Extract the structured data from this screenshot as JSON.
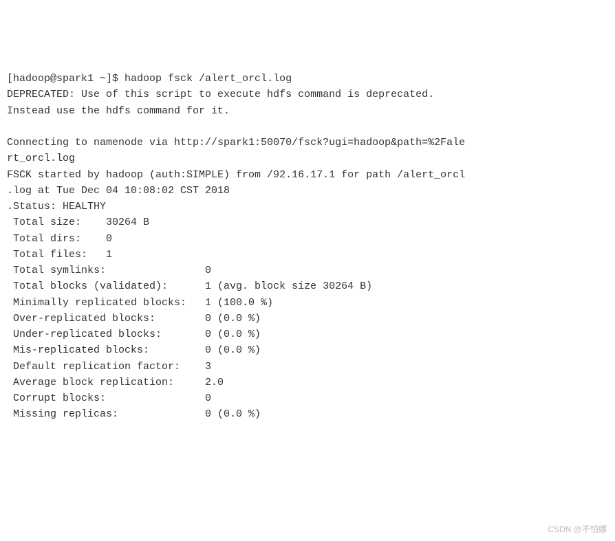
{
  "terminal": {
    "prompt": "[hadoop@spark1 ~]$ ",
    "command": "hadoop fsck /alert_orcl.log",
    "deprecated_line1": "DEPRECATED: Use of this script to execute hdfs command is deprecated.",
    "deprecated_line2": "Instead use the hdfs command for it.",
    "blank1": "",
    "connect_line1": "Connecting to namenode via http://spark1:50070/fsck?ugi=hadoop&path=%2Fale",
    "connect_line2": "rt_orcl.log",
    "fsck_line1": "FSCK started by hadoop (auth:SIMPLE) from /92.16.17.1 for path /alert_orcl",
    "fsck_line2": ".log at Tue Dec 04 10:08:02 CST 2018",
    "status_line": ".Status: HEALTHY",
    "stats": {
      "total_size": " Total size:    30264 B",
      "total_dirs": " Total dirs:    0",
      "total_files": " Total files:   1",
      "total_symlinks": " Total symlinks:                0",
      "total_blocks": " Total blocks (validated):      1 (avg. block size 30264 B)",
      "min_repl": " Minimally replicated blocks:   1 (100.0 %)",
      "over_repl": " Over-replicated blocks:        0 (0.0 %)",
      "under_repl": " Under-replicated blocks:       0 (0.0 %)",
      "mis_repl": " Mis-replicated blocks:         0 (0.0 %)",
      "def_repl": " Default replication factor:    3",
      "avg_repl": " Average block replication:     2.0",
      "corrupt": " Corrupt blocks:                0",
      "missing": " Missing replicas:              0 (0.0 %)"
    }
  },
  "watermark": "CSDN @不怕娜"
}
